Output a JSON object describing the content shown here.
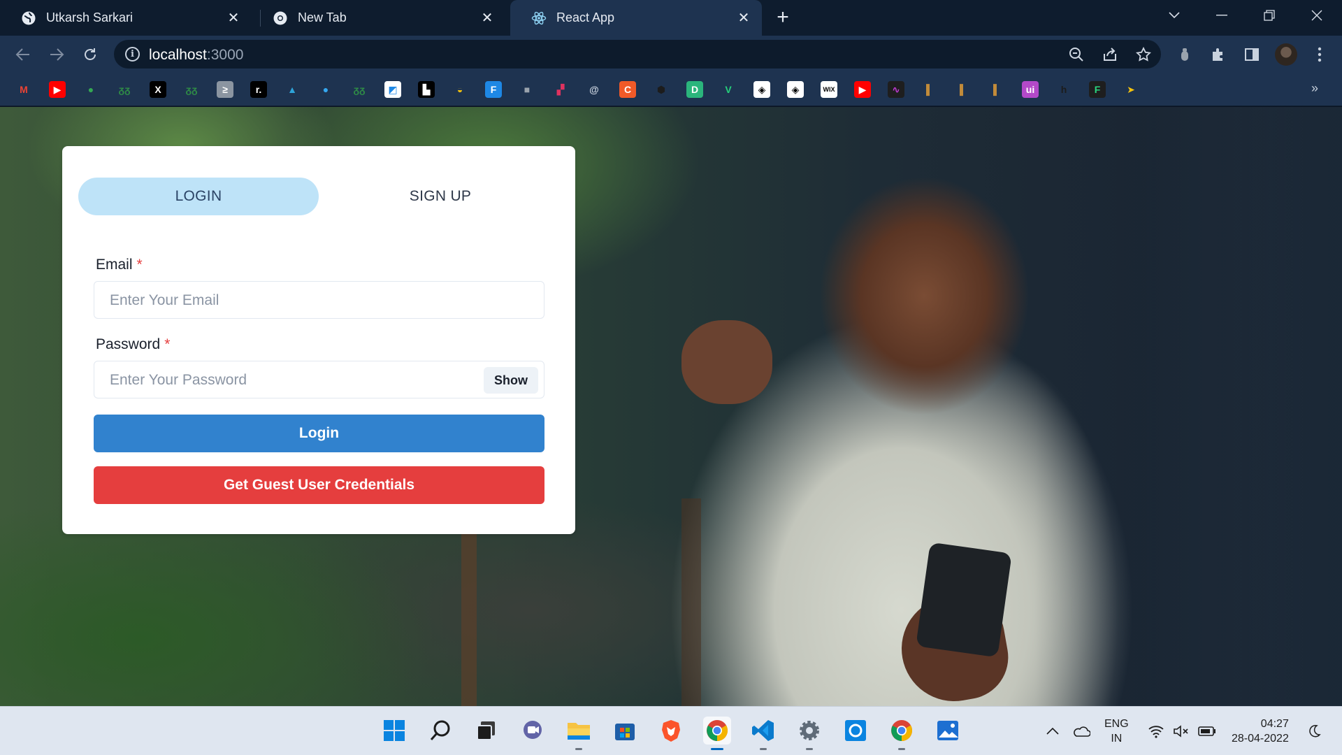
{
  "browser": {
    "tabs": [
      {
        "title": "Utkarsh Sarkari",
        "favicon": "globe-icon",
        "active": false
      },
      {
        "title": "New Tab",
        "favicon": "chrome-icon",
        "active": false
      },
      {
        "title": "React App",
        "favicon": "react-icon",
        "active": true
      }
    ],
    "new_tab_label": "+",
    "address": {
      "host": "localhost",
      "port": ":3000"
    },
    "bookmarks_overflow": "»",
    "bookmarks": [
      {
        "name": "gmail-icon",
        "glyph": "M",
        "color": "#ea4335",
        "bg": "transparent"
      },
      {
        "name": "youtube-icon",
        "glyph": "▶",
        "color": "#ffffff",
        "bg": "#ff0000"
      },
      {
        "name": "maps-icon",
        "glyph": "●",
        "color": "#34a853",
        "bg": "transparent"
      },
      {
        "name": "geeksforgeeks-icon",
        "glyph": "ᵹᵹ",
        "color": "#2f8d46",
        "bg": "transparent"
      },
      {
        "name": "x-icon",
        "glyph": "X",
        "color": "#ffffff",
        "bg": "#000000"
      },
      {
        "name": "geeksforgeeks-icon-2",
        "glyph": "ᵹᵹ",
        "color": "#2f8d46",
        "bg": "transparent"
      },
      {
        "name": "terminal-icon",
        "glyph": "≥",
        "color": "#ffffff",
        "bg": "#8b95a1"
      },
      {
        "name": "replit-icon",
        "glyph": "r.",
        "color": "#ffffff",
        "bg": "#000000"
      },
      {
        "name": "mountain-icon",
        "glyph": "▲",
        "color": "#2ea4d9",
        "bg": "transparent"
      },
      {
        "name": "dot-icon",
        "glyph": "●",
        "color": "#35a8f0",
        "bg": "transparent"
      },
      {
        "name": "geeksforgeeks-icon-3",
        "glyph": "ᵹᵹ",
        "color": "#2f8d46",
        "bg": "transparent"
      },
      {
        "name": "box-icon",
        "glyph": "◩",
        "color": "#1e88e5",
        "bg": "#ffffff"
      },
      {
        "name": "black-box-icon",
        "glyph": "▙",
        "color": "#ffffff",
        "bg": "#000000"
      },
      {
        "name": "bee-icon",
        "glyph": "◒",
        "color": "#f4c20d",
        "bg": "transparent"
      },
      {
        "name": "frontend-icon",
        "glyph": "F",
        "color": "#ffffff",
        "bg": "#1e88e5"
      },
      {
        "name": "cube-icon",
        "glyph": "■",
        "color": "#9aa3ad",
        "bg": "transparent"
      },
      {
        "name": "blocks-icon",
        "glyph": "▞",
        "color": "#e0325f",
        "bg": "transparent"
      },
      {
        "name": "circle-a-icon",
        "glyph": "@",
        "color": "#c9d2de",
        "bg": "transparent"
      },
      {
        "name": "codechef-icon",
        "glyph": "C",
        "color": "#ffffff",
        "bg": "#f05a28"
      },
      {
        "name": "hackerearth-icon",
        "glyph": "⬢",
        "color": "#1c1c1c",
        "bg": "transparent"
      },
      {
        "name": "d-icon",
        "glyph": "D",
        "color": "#ffffff",
        "bg": "#2bb57c"
      },
      {
        "name": "vuetify-icon",
        "glyph": "V",
        "color": "#25d07b",
        "bg": "transparent"
      },
      {
        "name": "codepen-icon",
        "glyph": "◈",
        "color": "#000000",
        "bg": "#ffffff"
      },
      {
        "name": "codepen-icon-2",
        "glyph": "◈",
        "color": "#000000",
        "bg": "#ffffff"
      },
      {
        "name": "wix-icon",
        "glyph": "WIX",
        "color": "#000000",
        "bg": "#ffffff"
      },
      {
        "name": "youtube-icon-2",
        "glyph": "▶",
        "color": "#ffffff",
        "bg": "#ff0000"
      },
      {
        "name": "wave-icon",
        "glyph": "∿",
        "color": "#c13bd6",
        "bg": "#1e1e1e"
      },
      {
        "name": "book-icon",
        "glyph": "▌",
        "color": "#c28b3a",
        "bg": "transparent"
      },
      {
        "name": "book-icon-2",
        "glyph": "▌",
        "color": "#c28b3a",
        "bg": "transparent"
      },
      {
        "name": "book-icon-3",
        "glyph": "▌",
        "color": "#c28b3a",
        "bg": "transparent"
      },
      {
        "name": "ui-icon",
        "glyph": "ui",
        "color": "#ffffff",
        "bg": "#b349c9"
      },
      {
        "name": "h-icon",
        "glyph": "h",
        "color": "#1c1c1c",
        "bg": "transparent"
      },
      {
        "name": "f-icon",
        "glyph": "F",
        "color": "#29d67f",
        "bg": "#1e1e1e"
      },
      {
        "name": "spark-icon",
        "glyph": "➤",
        "color": "#f4c20d",
        "bg": "transparent"
      }
    ]
  },
  "auth": {
    "tabs": {
      "login": "LOGIN",
      "signup": "SIGN UP"
    },
    "email": {
      "label": "Email",
      "required_mark": "*",
      "placeholder": "Enter Your Email"
    },
    "password": {
      "label": "Password",
      "required_mark": "*",
      "placeholder": "Enter Your Password",
      "toggle_label": "Show"
    },
    "login_button": "Login",
    "guest_button": "Get Guest User Credentials"
  },
  "taskbar": {
    "apps": [
      {
        "name": "windows-start-icon",
        "active": false,
        "running": false
      },
      {
        "name": "search-icon",
        "active": false,
        "running": false
      },
      {
        "name": "task-view-icon",
        "active": false,
        "running": false
      },
      {
        "name": "teams-chat-icon",
        "active": false,
        "running": false
      },
      {
        "name": "file-explorer-icon",
        "active": false,
        "running": true
      },
      {
        "name": "microsoft-store-icon",
        "active": false,
        "running": false
      },
      {
        "name": "brave-icon",
        "active": false,
        "running": false
      },
      {
        "name": "chrome-icon",
        "active": true,
        "running": true
      },
      {
        "name": "vscode-icon",
        "active": false,
        "running": true
      },
      {
        "name": "settings-icon",
        "active": false,
        "running": true
      },
      {
        "name": "cortana-icon",
        "active": false,
        "running": false
      },
      {
        "name": "chrome-icon-2",
        "active": false,
        "running": true
      },
      {
        "name": "photos-icon",
        "active": false,
        "running": false
      }
    ],
    "tray": {
      "language_top": "ENG",
      "language_bottom": "IN",
      "time": "04:27",
      "date": "28-04-2022"
    }
  },
  "colors": {
    "login_button": "#3182ce",
    "guest_button": "#e53e3e",
    "active_tab": "#bee3f8",
    "required": "#e53e3e"
  }
}
